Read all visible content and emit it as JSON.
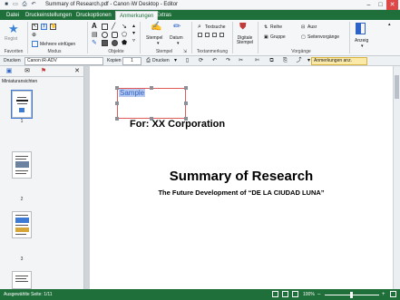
{
  "window": {
    "title": "Summary of Research.pdf - Canon iW Desktop - Editor"
  },
  "ribbon": {
    "tabs": [
      {
        "label": "Datei"
      },
      {
        "label": "Druckeinstellungen"
      },
      {
        "label": "Druckoptionen"
      },
      {
        "label": "Anmerkungen"
      },
      {
        "label": "Extras"
      }
    ],
    "modus": {
      "register_label": "Regist",
      "multi_insert_label": "Mehrere einfügen"
    },
    "stempel": {
      "stempel_label": "Stempel",
      "datum_label": "Datum"
    },
    "textsuche_label": "Textsuche",
    "digitaler_stempel_label": "Digitale Stempel",
    "reihe_label": "Reihe",
    "gruppe_label": "Gruppe",
    "ausr_label": "Ausr",
    "seitenvorgaenge_label": "Seitenvorgänge",
    "anzeige_label": "Anzeig",
    "groups": [
      {
        "label": "Favoriten"
      },
      {
        "label": "Modus"
      },
      {
        "label": "Objekte"
      },
      {
        "label": "Stempel"
      },
      {
        "label": "Textanmerkung"
      },
      {
        "label": "Vorgänge"
      }
    ]
  },
  "cmdbar": {
    "drucken_label": "Drucken",
    "printer_value": "Canon iR-ADV",
    "kopien_label": "Kopien",
    "kopien_value": "1",
    "drucken_button_label": "Drucken",
    "anmerkungen_anz_label": "Anmerkungen anz."
  },
  "sidebar": {
    "title": "Miniaturansichten",
    "pages": [
      {
        "number": "1"
      },
      {
        "number": "2"
      },
      {
        "number": "3"
      }
    ]
  },
  "document": {
    "annotation_text": "Sample",
    "for_line": "For: XX Corporation",
    "heading": "Summary of Research",
    "subheading": "The Future Development of “DE LA CIUDAD LUNA”"
  },
  "statusbar": {
    "left_text": "Ausgewählte Seite: 1/11",
    "zoom_value": "100%"
  },
  "colors": {
    "accent": "#1f6f3a",
    "annotation_border": "#e05a5a",
    "annotation_text": "#2d63c8",
    "selection": "#b7c9ee"
  },
  "icons": [
    "star-icon",
    "text-icon",
    "shape-icon",
    "stamp-icon",
    "date-stamp-icon",
    "search-icon",
    "digital-stamp-icon",
    "print-icon",
    "minimize-icon",
    "maximize-icon",
    "close-icon"
  ]
}
